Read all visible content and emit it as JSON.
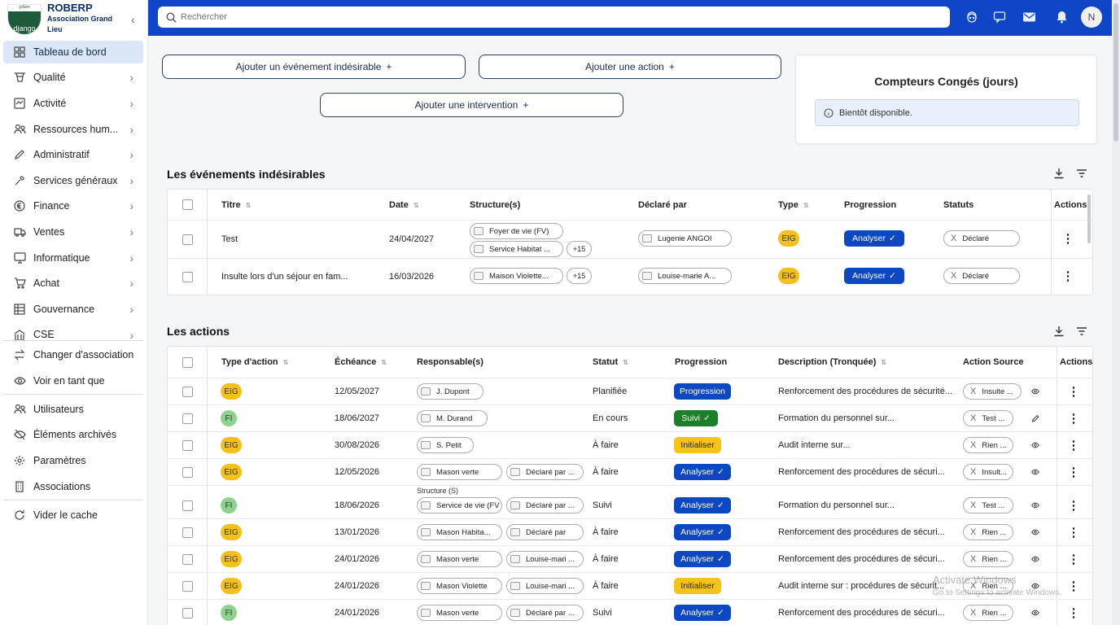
{
  "brand": {
    "logo_top": "gdlam",
    "logo_text": "django",
    "title": "ROBERP",
    "subtitle": "Association Grand Lieu"
  },
  "sidebar": {
    "items": [
      {
        "label": "Tableau de bord",
        "icon": "dashboard-icon"
      },
      {
        "label": "Qualité",
        "icon": "quality-icon"
      },
      {
        "label": "Activité",
        "icon": "activity-icon"
      },
      {
        "label": "Ressources hum...",
        "icon": "people-icon"
      },
      {
        "label": "Administratif",
        "icon": "pen-icon"
      },
      {
        "label": "Services généraux",
        "icon": "tools-icon"
      },
      {
        "label": "Finance",
        "icon": "euro-icon"
      },
      {
        "label": "Ventes",
        "icon": "truck-icon"
      },
      {
        "label": "Informatique",
        "icon": "monitor-icon"
      },
      {
        "label": "Achat",
        "icon": "cart-icon"
      },
      {
        "label": "Gouvernance",
        "icon": "table-icon"
      },
      {
        "label": "CSE",
        "icon": "bank-icon"
      }
    ],
    "bottom": [
      {
        "label": "Changer d'association",
        "icon": "swap-icon"
      },
      {
        "label": "Voir en tant que",
        "icon": "eye-icon"
      },
      {
        "label": "Utilisateurs",
        "icon": "users-icon"
      },
      {
        "label": "Éléments archivés",
        "icon": "eye-off-icon"
      },
      {
        "label": "Paramètres",
        "icon": "gear-icon"
      },
      {
        "label": "Associations",
        "icon": "building-icon"
      },
      {
        "label": "Vider le cache",
        "icon": "refresh-icon"
      }
    ]
  },
  "topbar": {
    "search_placeholder": "Rechercher",
    "avatar": "N"
  },
  "actions": {
    "add_event": "Ajouter un événement indésirable",
    "add_action": "Ajouter une action",
    "add_intervention": "Ajouter une intervention"
  },
  "conges": {
    "title": "Compteurs Congés (jours)",
    "info": "Bientôt disponible."
  },
  "events": {
    "title": "Les événements indésirables",
    "headers": {
      "titre": "Titre",
      "date": "Date",
      "structures": "Structure(s)",
      "declare": "Déclaré par",
      "type": "Type",
      "progression": "Progression",
      "statuts": "Statuts",
      "actions": "Actions"
    },
    "rows": [
      {
        "titre": "Test",
        "date": "24/04/2027",
        "struct1": "Foyer de vie (FV)",
        "struct2": "Service Habitat ...",
        "more": "+15",
        "declare": "Lugenie ANGOI",
        "type": "EIG",
        "progression": "Analyser",
        "statut": "Déclaré"
      },
      {
        "titre": "Insulte lors d'un séjour en fam...",
        "date": "16/03/2026",
        "struct1": "Maison Violette...",
        "more": "+15",
        "declare": "Louise-marie A...",
        "type": "EIG",
        "progression": "Analyser",
        "statut": "Déclaré"
      }
    ]
  },
  "action_list": {
    "title": "Les actions",
    "headers": {
      "type": "Type d'action",
      "echeance": "Échéance",
      "responsables": "Responsable(s)",
      "statut": "Statut",
      "progression": "Progression",
      "description": "Description (Tronquée)",
      "source": "Action Source",
      "actions": "Actions"
    },
    "rows": [
      {
        "type": "EIG",
        "echeance": "12/05/2027",
        "resp1": "J. Dupont",
        "statut": "Planifiée",
        "progression": "Progression",
        "description": "Renforcement des procédures de sécurité...",
        "source": "Insulte ...",
        "view": "eye"
      },
      {
        "type": "FI",
        "echeance": "18/06/2027",
        "resp1": "M. Durand",
        "statut": "En cours",
        "progression": "Suivi",
        "description": "Formation du personnel sur...",
        "source": "Test ...",
        "view": "pencil"
      },
      {
        "type": "EIG",
        "echeance": "30/08/2026",
        "resp1": "S. Petit",
        "statut": "À faire",
        "progression": "Initialiser",
        "description": "Audit interne sur...",
        "source": "Rien ...",
        "view": "eye"
      },
      {
        "type": "EIG",
        "echeance": "12/05/2026",
        "resp1": "Mason verte",
        "resp2": "Déclaré par ...",
        "statut": "À faire",
        "progression": "Analyser",
        "description": "Renforcement des procédures de sécuri...",
        "source": "Insult...",
        "view": "eye"
      },
      {
        "type": "FI",
        "echeance": "18/06/2026",
        "label": "Structure (S)",
        "resp1": "Service de vie (FV",
        "resp2": "Déclaré par ...",
        "statut": "Suivi",
        "progression": "Analyser",
        "description": "Formation du personnel sur...",
        "source": "Test ...",
        "view": "eye"
      },
      {
        "type": "EIG",
        "echeance": "13/01/2026",
        "resp1": "Mason Habita...",
        "resp2": "Déclaré par",
        "statut": "À faire",
        "progression": "Analyser",
        "description": "Renforcement des procédures de sécuri...",
        "source": "Rien ...",
        "view": "eye"
      },
      {
        "type": "EIG",
        "echeance": "24/01/2026",
        "resp1": "Mason verte",
        "resp2": "Louise-mari ...",
        "statut": "À faire",
        "progression": "Analyser",
        "description": "Renforcement des procédures de sécuri...",
        "source": "Rien ...",
        "view": "eye"
      },
      {
        "type": "EIG",
        "echeance": "24/01/2026",
        "resp1": "Mason Violette",
        "resp2": "Louise-mari ...",
        "statut": "À faire",
        "progression": "Initialiser",
        "description": "Audit interne sur : procédures de sécurit...",
        "source": "Rien ...",
        "view": "eye"
      },
      {
        "type": "FI",
        "echeance": "24/01/2026",
        "resp1": "Mason verte",
        "resp2": "Déclaré par ...",
        "statut": "Suivi",
        "progression": "Analyser",
        "description": "Renforcement des procédures de sécuri...",
        "source": "Rien ...",
        "view": "eye"
      }
    ]
  },
  "watermark": {
    "line1": "Activate Windows",
    "line2": "Go to Settings to activate Windows."
  },
  "colors": {
    "primary": "#0f46c8",
    "eig": "#f4c01e",
    "fi": "#8fd18f",
    "progress_blue": "#0d47c2",
    "suivi_green": "#1c7f2a",
    "initialiser_yellow": "#f6c21c"
  }
}
